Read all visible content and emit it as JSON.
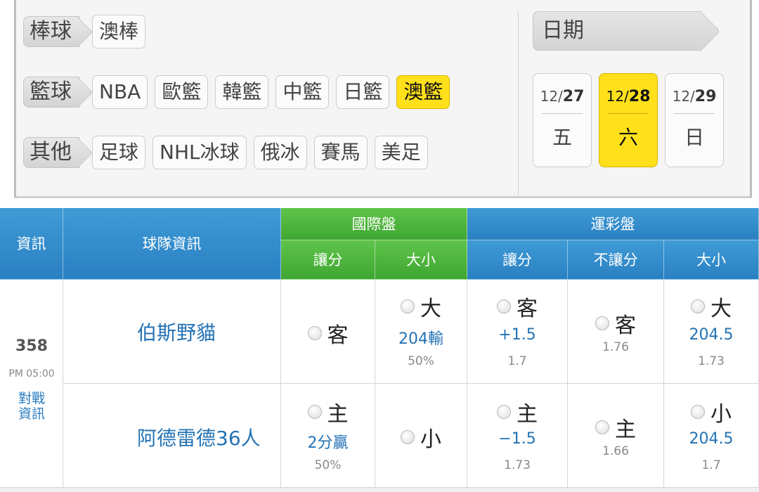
{
  "filters": {
    "baseball": {
      "label": "棒球",
      "chips": [
        "澳棒"
      ]
    },
    "basketball": {
      "label": "籃球",
      "chips": [
        "NBA",
        "歐籃",
        "韓籃",
        "中籃",
        "日籃",
        "澳籃"
      ],
      "active": "澳籃"
    },
    "other": {
      "label": "其他",
      "chips": [
        "足球",
        "NHL冰球",
        "俄冰",
        "賽馬",
        "美足"
      ]
    }
  },
  "dates": {
    "label": "日期",
    "days": [
      {
        "month": "12/",
        "day": "27",
        "weekday": "五"
      },
      {
        "month": "12/",
        "day": "28",
        "weekday": "六",
        "active": true
      },
      {
        "month": "12/",
        "day": "29",
        "weekday": "日"
      }
    ]
  },
  "table": {
    "headers": {
      "info": "資訊",
      "team_info": "球隊資訊",
      "intl": "國際盤",
      "intl_spread": "讓分",
      "intl_total": "大小",
      "lottery": "運彩盤",
      "lot_spread": "讓分",
      "lot_moneyline": "不讓分",
      "lot_total": "大小"
    },
    "game": {
      "number": "358",
      "time": "PM 05:00",
      "h2h_line1": "對戰",
      "h2h_line2": "資訊",
      "away": {
        "name": "伯斯野貓",
        "intl_spread_pick": "客",
        "intl_total_pick": "大",
        "intl_total_line": "204輸",
        "intl_total_pct": "50%",
        "lot_spread_pick": "客",
        "lot_spread_line": "+1.5",
        "lot_spread_odds": "1.7",
        "lot_ml_pick": "客",
        "lot_ml_odds": "1.76",
        "lot_total_pick": "大",
        "lot_total_line": "204.5",
        "lot_total_odds": "1.73"
      },
      "home": {
        "name": "阿德雷德36人",
        "intl_spread_pick": "主",
        "intl_spread_line": "2分贏",
        "intl_spread_pct": "50%",
        "intl_total_pick": "小",
        "lot_spread_pick": "主",
        "lot_spread_line": "−1.5",
        "lot_spread_odds": "1.73",
        "lot_ml_pick": "主",
        "lot_ml_odds": "1.66",
        "lot_total_pick": "小",
        "lot_total_line": "204.5",
        "lot_total_odds": "1.7"
      }
    }
  },
  "colors": {
    "accent_yellow": "#ffe01b",
    "header_blue": "#2a80c2",
    "header_green": "#3fa632",
    "link_blue": "#2473b5"
  }
}
